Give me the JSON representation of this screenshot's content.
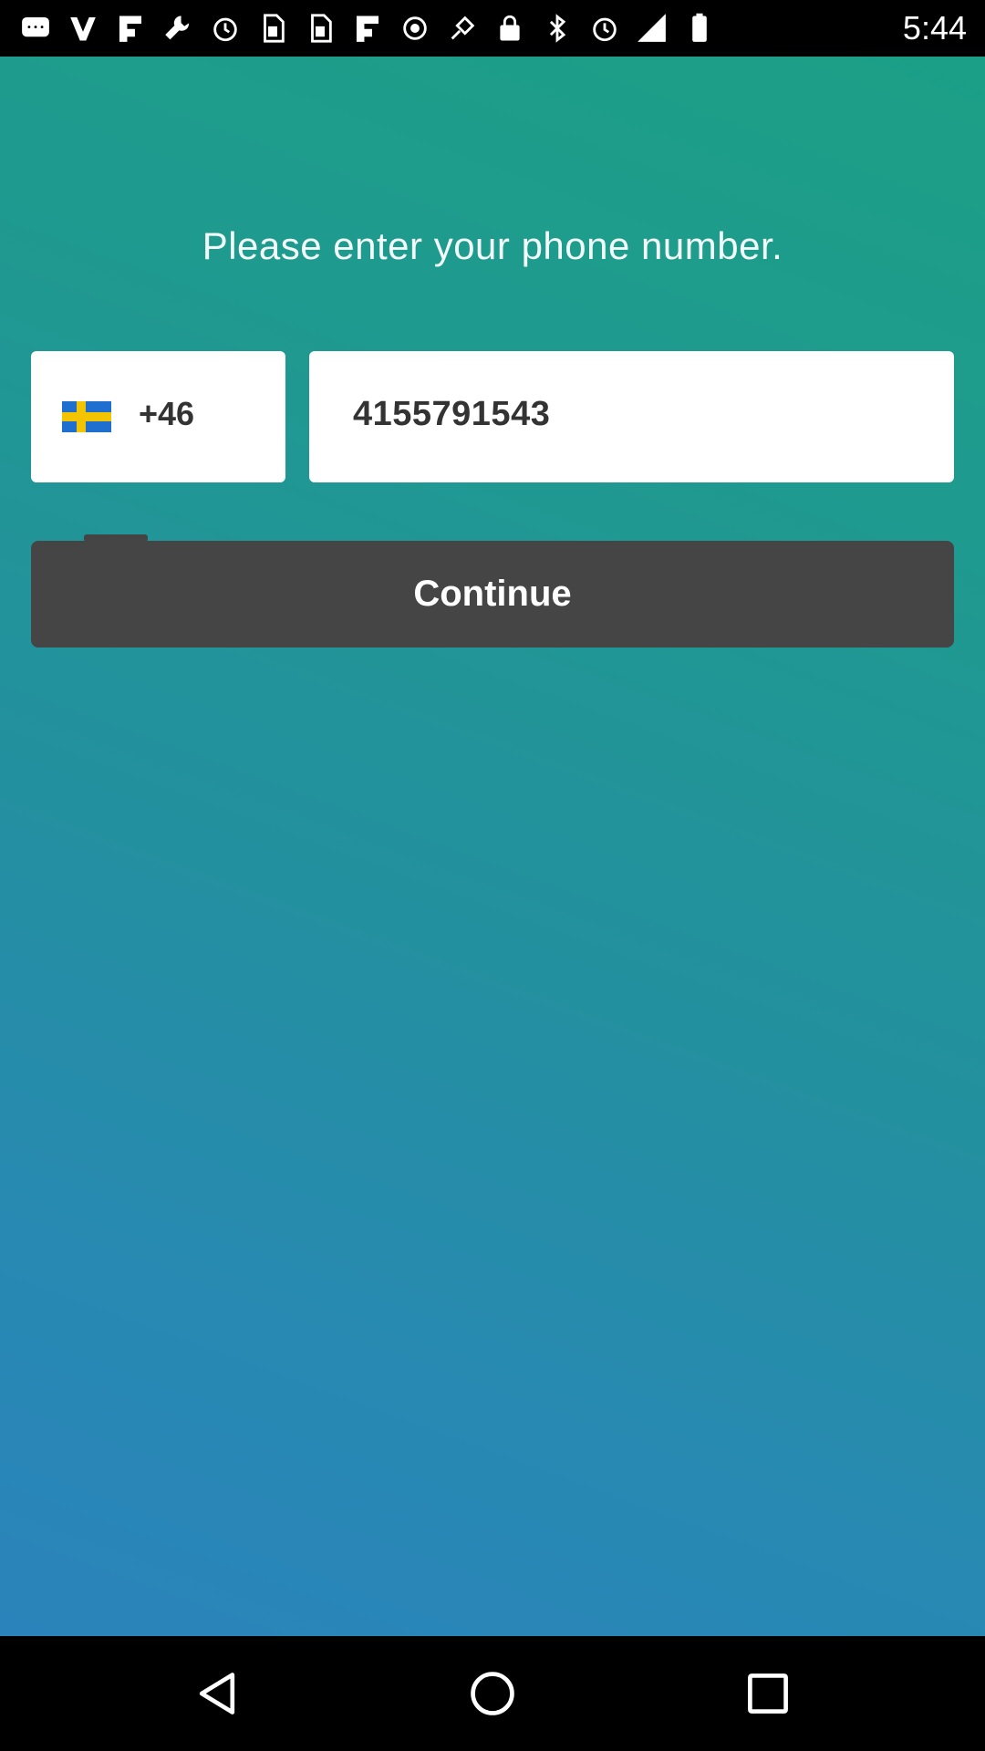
{
  "status_bar": {
    "time": "5:44",
    "icons": [
      "chat-icon",
      "vine-icon",
      "flipboard-icon",
      "wrench-icon",
      "alarm-icon",
      "sim-icon",
      "sim-icon",
      "flipboard-icon",
      "location-icon",
      "gps-fake-icon",
      "lock-icon",
      "bluetooth-icon",
      "alarm-icon",
      "signal-icon",
      "battery-icon"
    ]
  },
  "screen": {
    "prompt": "Please enter your phone number.",
    "country": {
      "flag": "sweden-flag",
      "code": "+46"
    },
    "phone": {
      "value": "4155791543"
    },
    "continue_label": "Continue"
  },
  "nav": {
    "back": "back-icon",
    "home": "home-icon",
    "recents": "recents-icon"
  }
}
